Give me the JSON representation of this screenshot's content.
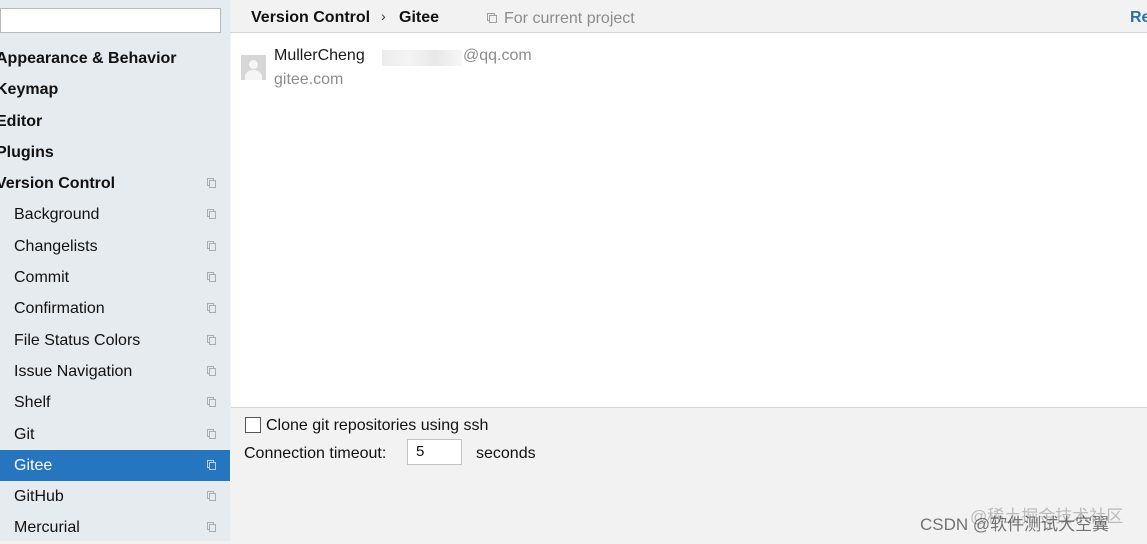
{
  "sidebar": {
    "search_value": "",
    "items": [
      {
        "label": "Appearance & Behavior"
      },
      {
        "label": "Keymap"
      },
      {
        "label": "Editor"
      },
      {
        "label": "Plugins"
      },
      {
        "label": "Version Control"
      },
      {
        "label": "Background"
      },
      {
        "label": "Changelists"
      },
      {
        "label": "Commit"
      },
      {
        "label": "Confirmation"
      },
      {
        "label": "File Status Colors"
      },
      {
        "label": "Issue Navigation"
      },
      {
        "label": "Shelf"
      },
      {
        "label": "Git"
      },
      {
        "label": "Gitee"
      },
      {
        "label": "GitHub"
      },
      {
        "label": "Mercurial"
      }
    ],
    "selected": "Gitee",
    "selected_color": "#2675bf"
  },
  "header": {
    "breadcrumb_parent": "Version Control",
    "breadcrumb_separator": "›",
    "breadcrumb_current": "Gitee",
    "scope_label": "For current project",
    "reset_label": "Re"
  },
  "account": {
    "name": "MullerCheng",
    "email_suffix": "@qq.com",
    "server": "gitee.com"
  },
  "options": {
    "clone_ssh_label": "Clone git repositories using ssh",
    "clone_ssh_checked": false,
    "timeout_label": "Connection timeout:",
    "timeout_value": "5",
    "timeout_unit": "seconds"
  },
  "watermark": {
    "text": "CSDN @软件测试大空翼",
    "overlay": "@稀土掘金技术社区"
  },
  "icons": [
    "copy-icon",
    "project-scope-icon",
    "avatar-icon"
  ]
}
